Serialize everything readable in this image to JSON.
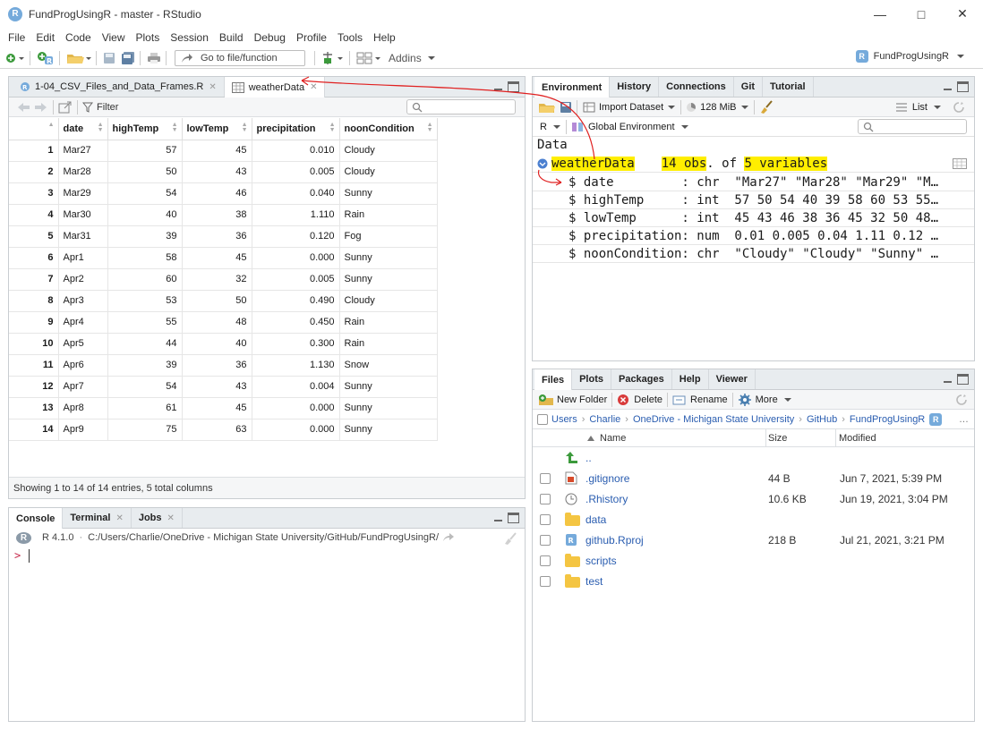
{
  "window": {
    "title": "FundProgUsingR - master - RStudio",
    "app_icon_letter": "R"
  },
  "menu": [
    "File",
    "Edit",
    "Code",
    "View",
    "Plots",
    "Session",
    "Build",
    "Debug",
    "Profile",
    "Tools",
    "Help"
  ],
  "toolbar": {
    "goto_placeholder": "Go to file/function",
    "addins_label": "Addins",
    "project_label": "FundProgUsingR"
  },
  "source_pane": {
    "tabs": [
      {
        "label": "1-04_CSV_Files_and_Data_Frames.R",
        "active": false
      },
      {
        "label": "weatherData",
        "active": true
      }
    ],
    "filter_label": "Filter",
    "columns": [
      "date",
      "highTemp",
      "lowTemp",
      "precipitation",
      "noonCondition"
    ],
    "rows": [
      [
        "1",
        "Mar27",
        "57",
        "45",
        "0.010",
        "Cloudy"
      ],
      [
        "2",
        "Mar28",
        "50",
        "43",
        "0.005",
        "Cloudy"
      ],
      [
        "3",
        "Mar29",
        "54",
        "46",
        "0.040",
        "Sunny"
      ],
      [
        "4",
        "Mar30",
        "40",
        "38",
        "1.110",
        "Rain"
      ],
      [
        "5",
        "Mar31",
        "39",
        "36",
        "0.120",
        "Fog"
      ],
      [
        "6",
        "Apr1",
        "58",
        "45",
        "0.000",
        "Sunny"
      ],
      [
        "7",
        "Apr2",
        "60",
        "32",
        "0.005",
        "Sunny"
      ],
      [
        "8",
        "Apr3",
        "53",
        "50",
        "0.490",
        "Cloudy"
      ],
      [
        "9",
        "Apr4",
        "55",
        "48",
        "0.450",
        "Rain"
      ],
      [
        "10",
        "Apr5",
        "44",
        "40",
        "0.300",
        "Rain"
      ],
      [
        "11",
        "Apr6",
        "39",
        "36",
        "1.130",
        "Snow"
      ],
      [
        "12",
        "Apr7",
        "54",
        "43",
        "0.004",
        "Sunny"
      ],
      [
        "13",
        "Apr8",
        "61",
        "45",
        "0.000",
        "Sunny"
      ],
      [
        "14",
        "Apr9",
        "75",
        "63",
        "0.000",
        "Sunny"
      ]
    ],
    "footer": "Showing 1 to 14 of 14 entries, 5 total columns"
  },
  "console_pane": {
    "tabs": [
      "Console",
      "Terminal",
      "Jobs"
    ],
    "r_version": "R 4.1.0",
    "path": "C:/Users/Charlie/OneDrive - Michigan State University/GitHub/FundProgUsingR/",
    "prompt": ">"
  },
  "env_pane": {
    "tabs": [
      "Environment",
      "History",
      "Connections",
      "Git",
      "Tutorial"
    ],
    "import_label": "Import Dataset",
    "memory": "128 MiB",
    "list_label": "List",
    "r_dropdown": "R",
    "env_dropdown": "Global Environment",
    "section_header": "Data",
    "object_name": "weatherData",
    "object_obs": "14 obs",
    "object_of": ". of ",
    "object_vars": "5 variables",
    "str_lines": [
      "$ date         : chr  \"Mar27\" \"Mar28\" \"Mar29\" \"M…",
      "$ highTemp     : int  57 50 54 40 39 58 60 53 55…",
      "$ lowTemp      : int  45 43 46 38 36 45 32 50 48…",
      "$ precipitation: num  0.01 0.005 0.04 1.11 0.12 …",
      "$ noonCondition: chr  \"Cloudy\" \"Cloudy\" \"Sunny\" …"
    ]
  },
  "files_pane": {
    "tabs": [
      "Files",
      "Plots",
      "Packages",
      "Help",
      "Viewer"
    ],
    "new_folder": "New Folder",
    "delete": "Delete",
    "rename": "Rename",
    "more": "More",
    "breadcrumb": [
      "Users",
      "Charlie",
      "OneDrive - Michigan State University",
      "GitHub",
      "FundProgUsingR"
    ],
    "headers": {
      "name": "Name",
      "size": "Size",
      "modified": "Modified"
    },
    "up_label": "..",
    "files": [
      {
        "name": ".gitignore",
        "size": "44 B",
        "modified": "Jun 7, 2021, 5:39 PM",
        "type": "git-file"
      },
      {
        "name": ".Rhistory",
        "size": "10.6 KB",
        "modified": "Jun 19, 2021, 3:04 PM",
        "type": "history-file"
      },
      {
        "name": "data",
        "size": "",
        "modified": "",
        "type": "folder"
      },
      {
        "name": "github.Rproj",
        "size": "218 B",
        "modified": "Jul 21, 2021, 3:21 PM",
        "type": "rproj-file"
      },
      {
        "name": "scripts",
        "size": "",
        "modified": "",
        "type": "folder"
      },
      {
        "name": "test",
        "size": "",
        "modified": "",
        "type": "folder"
      }
    ]
  },
  "colors": {
    "highlight": "#ffee00",
    "annotation": "#e02020",
    "link": "#2a5db0"
  }
}
